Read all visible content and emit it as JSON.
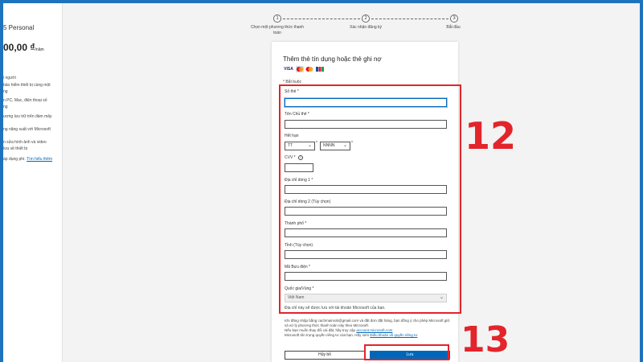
{
  "sidebar": {
    "title": "5 Personal",
    "price": "00,00 ₫",
    "price_unit": "/năm",
    "features": [
      "i người",
      "bảo hiểm thiết bị cùng một",
      "ng",
      "n PC, Mac, điện thoại số",
      "ng",
      "ượng lưu trữ trên đám mây",
      "ng năng suất với Microsoft",
      "n sửa hình ảnh và video",
      "lưu về thiết bị"
    ],
    "link_prefix": "áp dụng phí.",
    "link_text": "Tìm hiểu thêm"
  },
  "stepper": {
    "steps": [
      {
        "number": "1",
        "label_line1": "Chọn một phương thức thanh",
        "label_line2": "toán"
      },
      {
        "number": "2",
        "label_line1": "Xác nhận đăng ký",
        "label_line2": ""
      },
      {
        "number": "3",
        "label_line1": "Bắt đầu",
        "label_line2": ""
      }
    ]
  },
  "card": {
    "title": "Thêm thẻ tín dụng hoặc thẻ ghi nợ",
    "logos": [
      "VISA",
      "MC",
      "AMEX",
      "JCB"
    ],
    "required_note": "* Bắt buộc",
    "fields": {
      "card_number": "Số thẻ *",
      "card_holder": "Tên Chủ thẻ *",
      "expiry": "Hết hạn",
      "month_placeholder": "TT",
      "year_placeholder": "NNNN",
      "cvv": "CVV *",
      "address1": "Địa chỉ dòng 1 *",
      "address2": "Địa chỉ dòng 2 (Tùy chọn)",
      "city": "Thành phố *",
      "province": "Tỉnh (Tùy chọn)",
      "postal": "Mã Bưu điện *",
      "country": "Quốc gia/Vùng *",
      "country_value": "Việt Nam"
    },
    "footer_note": "Địa chỉ này sẽ được lưu với tài khoản Microsoft của bạn.",
    "disclaimer_line1": "Khi đăng nhập bằng cachmaimob@gmail.com và đặt đơn đặt hàng, bạn đồng ý cho phép Microsoft giữ",
    "disclaimer_line2": "và xử lý phương thức thanh toán này theo Microsoft.",
    "disclaimer_line3_prefix": "Nếu bạn muốn thay đổi cài đặt, hãy truy cập",
    "disclaimer_link1": "account.microsoft.com",
    "disclaimer_line4_prefix": "Microsoft tôn trọng quyền riêng tư của bạn. Hãy xem",
    "disclaimer_link2": "Điều khoản về quyền riêng tư",
    "cancel_label": "Hủy bỏ",
    "save_label": "Lưu"
  },
  "annotations": {
    "label_12": "12",
    "label_13": "13",
    "color": "#e3242b"
  },
  "colors": {
    "frame_border": "#1e73be",
    "primary_button": "#0067b8"
  }
}
